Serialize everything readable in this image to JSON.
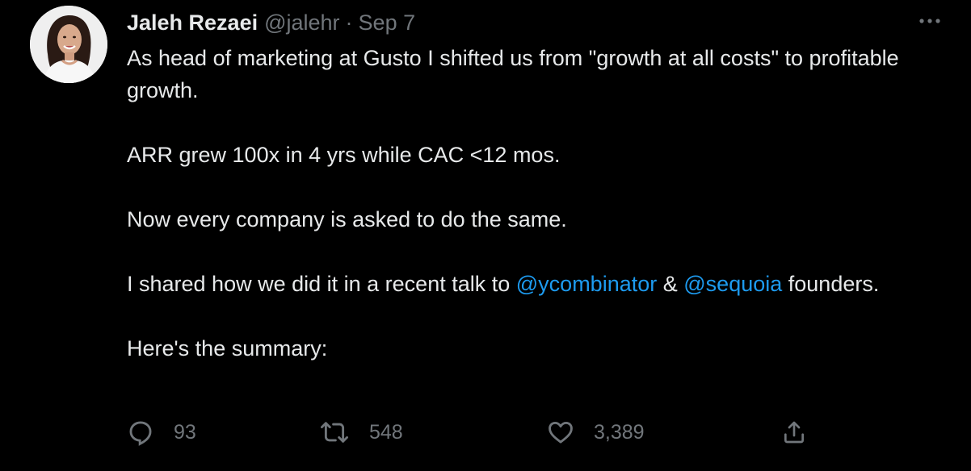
{
  "author": {
    "display_name": "Jaleh Rezaei",
    "handle": "@jalehr",
    "separator": "·",
    "date": "Sep 7"
  },
  "tweet": {
    "paragraphs": [
      [
        {
          "type": "text",
          "text": "As head of marketing at Gusto I shifted us from \"growth at all costs\" to profitable growth."
        }
      ],
      [
        {
          "type": "text",
          "text": "ARR grew 100x in 4 yrs while CAC <12 mos."
        }
      ],
      [
        {
          "type": "text",
          "text": "Now every company is asked to do the same."
        }
      ],
      [
        {
          "type": "text",
          "text": "I shared how we did it in a recent talk to "
        },
        {
          "type": "mention",
          "text": "@ycombinator"
        },
        {
          "type": "text",
          "text": " & "
        },
        {
          "type": "mention",
          "text": "@sequoia"
        },
        {
          "type": "text",
          "text": " founders."
        }
      ],
      [
        {
          "type": "text",
          "text": "Here's the summary:"
        }
      ]
    ]
  },
  "actions": {
    "reply_count": "93",
    "retweet_count": "548",
    "like_count": "3,389",
    "reply_icon": "reply-icon",
    "retweet_icon": "retweet-icon",
    "like_icon": "heart-icon",
    "share_icon": "share-icon"
  },
  "colors": {
    "background": "#000000",
    "text_primary": "#e7e9ea",
    "text_secondary": "#71767b",
    "link": "#1d9bf0"
  }
}
